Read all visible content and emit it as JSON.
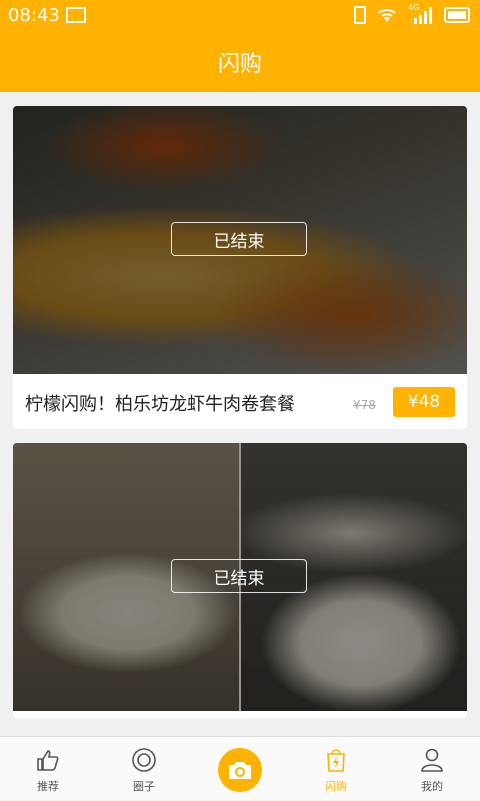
{
  "status": {
    "time": "08:43",
    "network": "4G"
  },
  "header": {
    "title": "闪购"
  },
  "deals": [
    {
      "title": "柠檬闪购！柏乐坊龙虾牛肉卷套餐",
      "original_price": "¥78",
      "price": "¥48",
      "status": "已结束"
    },
    {
      "title": "",
      "status": "已结束"
    }
  ],
  "tabs": [
    {
      "label": "推荐",
      "icon": "thumbs-up-icon"
    },
    {
      "label": "圈子",
      "icon": "circle-icon"
    },
    {
      "label": "",
      "icon": "camera-icon"
    },
    {
      "label": "闪购",
      "icon": "lightning-bag-icon",
      "active": true
    },
    {
      "label": "我的",
      "icon": "person-icon"
    }
  ],
  "colors": {
    "accent": "#ffb300",
    "background": "#f0f0f0"
  }
}
